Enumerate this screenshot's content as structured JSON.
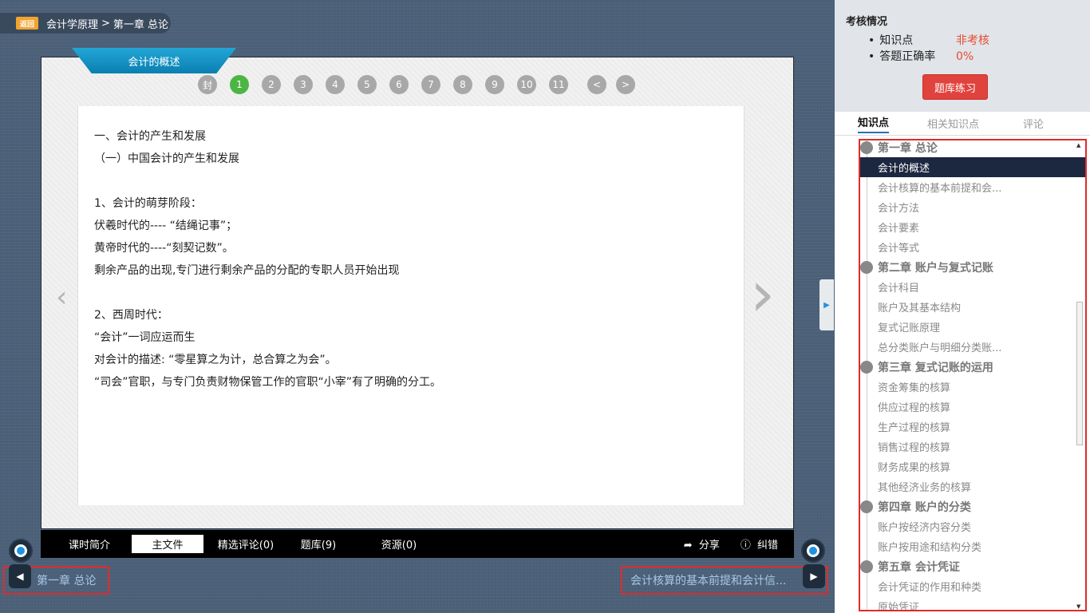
{
  "breadcrumb": {
    "back_label": "返回",
    "course": "会计学原理",
    "separator": ">",
    "chapter": "第一章 总论"
  },
  "viewer": {
    "section_title": "会计的概述",
    "pages": [
      "封",
      "1",
      "2",
      "3",
      "4",
      "5",
      "6",
      "7",
      "8",
      "9",
      "10",
      "11"
    ],
    "active_page": "1",
    "prev_label": "<",
    "next_label": ">",
    "content": [
      "一、会计的产生和发展",
      "（一）中国会计的产生和发展",
      "",
      "1、会计的萌芽阶段：",
      "伏羲时代的---- “结绳记事”；",
      "黄帝时代的----“刻契记数”。",
      "剩余产品的出现,专门进行剩余产品的分配的专职人员开始出现",
      "",
      "2、西周时代：",
      "“会计”一词应运而生",
      "对会计的描述: “零星算之为计，总合算之为会”。",
      "“司会”官职，与专门负责财物保管工作的官职“小宰”有了明确的分工。"
    ]
  },
  "bottom_bar": {
    "tabs": [
      "课时简介",
      "主文件",
      "精选评论(0)",
      "题库(9)",
      "资源(0)"
    ],
    "active_tab": "主文件",
    "share_label": "分享",
    "report_label": "纠错"
  },
  "navigation": {
    "prev_title": "第一章 总论",
    "next_title": "会计核算的基本前提和会计信..."
  },
  "assessment": {
    "title": "考核情况",
    "knowledge_label": "知识点",
    "knowledge_value": "非考核",
    "accuracy_label": "答题正确率",
    "accuracy_value": "0%",
    "practice_button": "题库练习"
  },
  "panel_tabs": {
    "items": [
      "知识点",
      "相关知识点",
      "评论"
    ],
    "active": "知识点"
  },
  "knowledge_points": [
    {
      "type": "chapter",
      "label": "第一章 总论"
    },
    {
      "type": "item",
      "label": "会计的概述",
      "active": true
    },
    {
      "type": "item",
      "label": "会计核算的基本前提和会..."
    },
    {
      "type": "item",
      "label": "会计方法"
    },
    {
      "type": "item",
      "label": "会计要素"
    },
    {
      "type": "item",
      "label": "会计等式"
    },
    {
      "type": "chapter",
      "label": "第二章 账户与复式记账"
    },
    {
      "type": "item",
      "label": "会计科目"
    },
    {
      "type": "item",
      "label": "账户及其基本结构"
    },
    {
      "type": "item",
      "label": "复式记账原理"
    },
    {
      "type": "item",
      "label": "总分类账户与明细分类账..."
    },
    {
      "type": "chapter",
      "label": "第三章 复式记账的运用"
    },
    {
      "type": "item",
      "label": "资金筹集的核算"
    },
    {
      "type": "item",
      "label": "供应过程的核算"
    },
    {
      "type": "item",
      "label": "生产过程的核算"
    },
    {
      "type": "item",
      "label": "销售过程的核算"
    },
    {
      "type": "item",
      "label": "财务成果的核算"
    },
    {
      "type": "item",
      "label": "其他经济业务的核算"
    },
    {
      "type": "chapter",
      "label": "第四章 账户的分类"
    },
    {
      "type": "item",
      "label": "账户按经济内容分类"
    },
    {
      "type": "item",
      "label": "账户按用途和结构分类"
    },
    {
      "type": "chapter",
      "label": "第五章 会计凭证"
    },
    {
      "type": "item",
      "label": "会计凭证的作用和种类"
    },
    {
      "type": "item",
      "label": "原始凭证"
    }
  ],
  "colors": {
    "accent_green": "#4cb543",
    "accent_blue": "#1e92e4",
    "accent_red": "#e0433d",
    "highlight_border": "#e02b2b",
    "active_row": "#1c2740"
  }
}
